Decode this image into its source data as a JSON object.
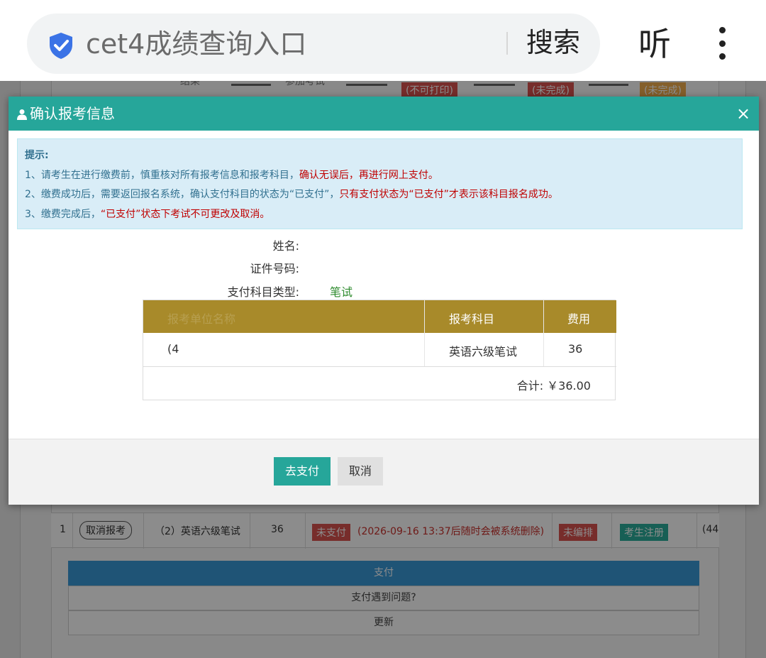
{
  "browser": {
    "search_text": "cet4成绩查询入口",
    "search_button": "搜索",
    "listen_button": "听"
  },
  "background": {
    "steps": [
      "结果",
      "参加考试"
    ],
    "step_tags": [
      "(不可打印)",
      "(未完成)",
      "(未完成)"
    ],
    "row": {
      "index": "1",
      "cancel_btn": "取消报考",
      "subject": "（2）英语六级笔试",
      "fee": "36",
      "status_tag": "未支付",
      "status_note": "(2026-09-16 13:37后随时会被系统删除)",
      "arrange_tag": "未编排",
      "register_tag": "考生注册",
      "code": "(44"
    },
    "pay_bar": "支付",
    "pay_problem": "支付遇到问题?",
    "refresh": "更新"
  },
  "modal": {
    "title": "确认报考信息",
    "tips": {
      "title": "提示:",
      "line1_a": "1、请考生在进行缴费前，慎重核对所有报考信息和报考科目，",
      "line1_b": "确认无误后，再进行网上支付。",
      "line2_a": "2、缴费成功后，需要返回报名系统，确认支付科目的状态为“已支付”，",
      "line2_b": "只有支付状态为“已支付”才表示该科目报名成功。",
      "line3_a": "3、缴费完成后，",
      "line3_b": "“已支付”状态下考试不可更改及取消。"
    },
    "info": {
      "name_label": "姓名:",
      "id_label": "证件号码:",
      "type_label": "支付科目类型:",
      "type_value": "笔试"
    },
    "table": {
      "headers": [
        "报考单位名称",
        "报考科目",
        "费用"
      ],
      "row": {
        "unit": "(4",
        "subject": "英语六级笔试",
        "fee": "36"
      },
      "total": "合计: ￥36.00"
    },
    "buttons": {
      "pay": "去支付",
      "cancel": "取消"
    }
  },
  "colors": {
    "header": "#26a69a",
    "tips_bg": "#d9edf7",
    "table_head": "#a88a2a",
    "warning_red": "#c00000"
  }
}
